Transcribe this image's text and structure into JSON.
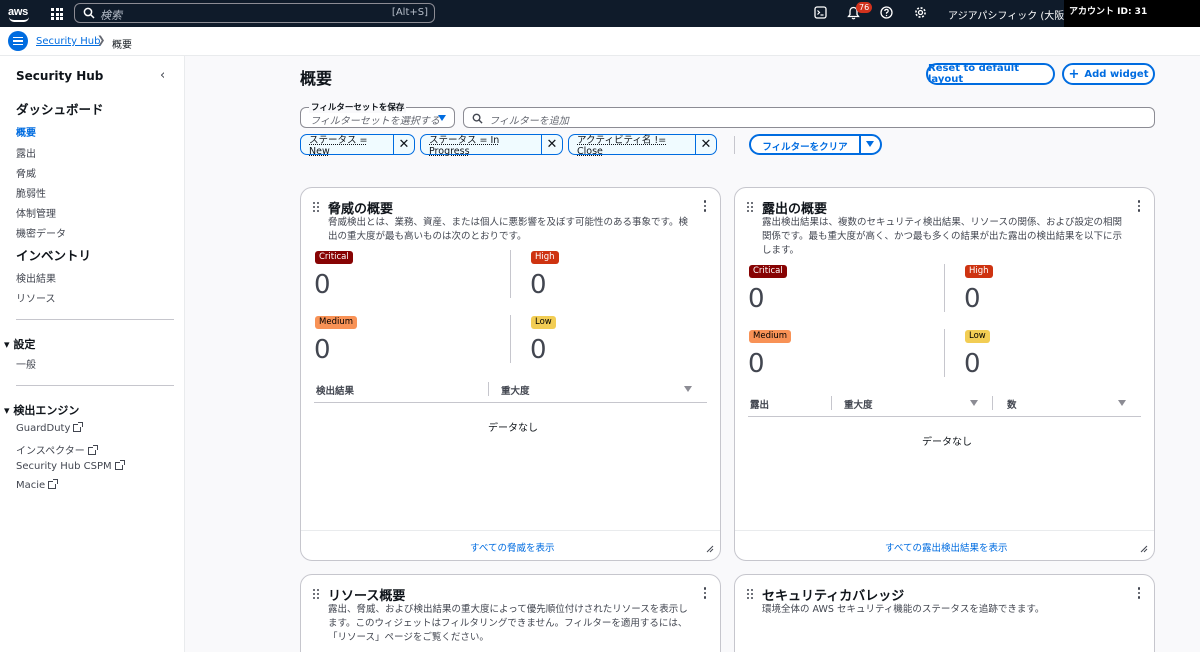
{
  "topnav": {
    "logo_text": "aws",
    "search_placeholder": "検索",
    "search_shortcut": "[Alt+S]",
    "notifications_count": "76",
    "region": "アジアパシフィック (大阪) ▾",
    "account": "アカウント ID: 31"
  },
  "breadcrumb": {
    "root": "Security Hub",
    "current": "概要"
  },
  "sidebar": {
    "title": "Security Hub",
    "dashboard_heading": "ダッシュボード",
    "dashboard_items": [
      "概要",
      "露出",
      "脅威",
      "脆弱性",
      "体制管理",
      "機密データ"
    ],
    "inventory_heading": "インベントリ",
    "inventory_items": [
      "検出結果",
      "リソース"
    ],
    "settings_heading": "設定",
    "settings_items": [
      "一般"
    ],
    "engines_heading": "検出エンジン",
    "engine_items": [
      "GuardDuty",
      "インスペクター",
      "Security Hub CSPM",
      "Macie"
    ]
  },
  "main": {
    "title": "概要",
    "reset_label": "Reset to default layout",
    "add_widget_label": "Add widget",
    "filterset_label": "フィルターセットを保存",
    "filterset_placeholder": "フィルターセットを選択する",
    "filter_placeholder": "フィルターを追加",
    "tokens": [
      "ステータス = New",
      "ステータス = In Progress",
      "アクティビティ名 != Close"
    ],
    "clear_filters_label": "フィルターをクリア"
  },
  "threat_card": {
    "title": "脅威の概要",
    "desc_line1": "脅威検出とは、業務、資産、または個人に悪影響を及ぼす可能性のある事象です。検",
    "desc_line2": "出の重大度が最も高いものは次のとおりです。",
    "critical_label": "Critical",
    "critical_count": "0",
    "high_label": "High",
    "high_count": "0",
    "medium_label": "Medium",
    "medium_count": "0",
    "low_label": "Low",
    "low_count": "0",
    "col1": "検出結果",
    "col2": "重大度",
    "empty": "データなし",
    "footer_link": "すべての脅威を表示"
  },
  "exposure_card": {
    "title": "露出の概要",
    "desc_line1": "露出検出結果は、複数のセキュリティ検出結果、リソースの関係、および設定の相関",
    "desc_line2": "関係です。最も重大度が高く、かつ最も多くの結果が出た露出の検出結果を以下に示",
    "desc_line3": "します。",
    "critical_label": "Critical",
    "critical_count": "0",
    "high_label": "High",
    "high_count": "0",
    "medium_label": "Medium",
    "medium_count": "0",
    "low_label": "Low",
    "low_count": "0",
    "col1": "露出",
    "col2": "重大度",
    "col3": "数",
    "empty": "データなし",
    "footer_link": "すべての露出検出結果を表示"
  },
  "resource_card": {
    "title": "リソース概要",
    "desc_line1": "露出、脅威、および検出結果の重大度によって優先順位付けされたリソースを表示し",
    "desc_line2": "ます。このウィジェットはフィルタリングできません。フィルターを適用するには、",
    "desc_line3": "「リソース」ページをご覧ください。"
  },
  "coverage_card": {
    "title": "セキュリティカバレッジ",
    "desc_line1": "環境全体の AWS セキュリティ機能のステータスを追跡できます。"
  }
}
